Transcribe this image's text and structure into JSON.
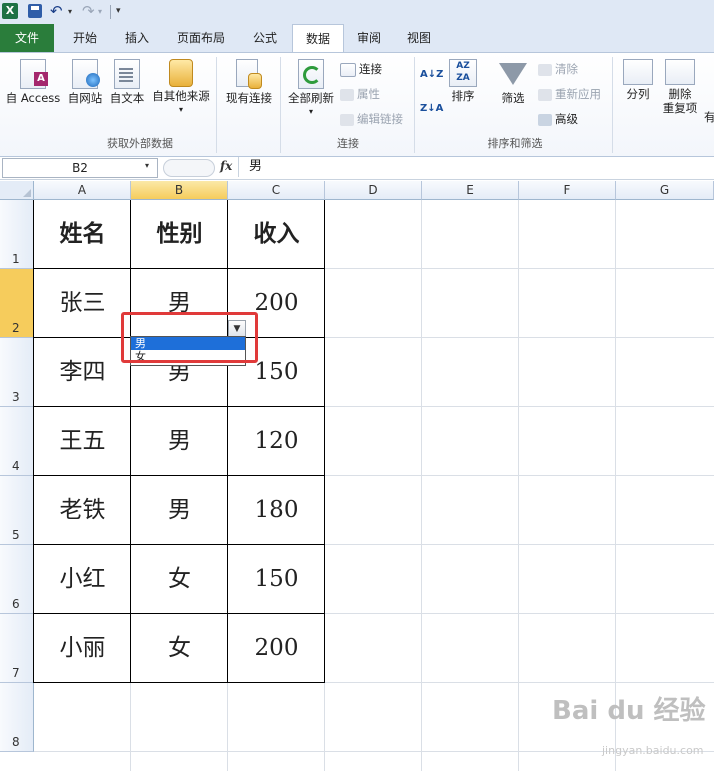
{
  "quick_access": {
    "app_icon": "X",
    "undo": "↶",
    "redo": "↷",
    "dropdown": "▾",
    "customize": "▾"
  },
  "tabs": [
    {
      "label": "文件",
      "type": "file"
    },
    {
      "label": "开始"
    },
    {
      "label": "插入"
    },
    {
      "label": "页面布局"
    },
    {
      "label": "公式"
    },
    {
      "label": "数据",
      "active": true
    },
    {
      "label": "审阅"
    },
    {
      "label": "视图"
    }
  ],
  "ribbon": {
    "external_data": {
      "group_label": "获取外部数据",
      "access": "自 Access",
      "web": "自网站",
      "text": "自文本",
      "other": "自其他来源",
      "existing": "现有连接"
    },
    "connections": {
      "group_label": "连接",
      "refresh_all": "全部刷新",
      "connections": "连接",
      "properties": "属性",
      "edit_links": "编辑链接"
    },
    "sort_filter": {
      "group_label": "排序和筛选",
      "sort_az": "A↓Z",
      "sort_za": "Z↓A",
      "sort": "排序",
      "filter": "筛选",
      "clear": "清除",
      "reapply": "重新应用",
      "advanced": "高级"
    },
    "data_tools": {
      "split": "分列",
      "remove": "删除",
      "duplicates": "重复项",
      "more": "有"
    }
  },
  "formula_bar": {
    "name_box": "B2",
    "fx": "fx",
    "formula": "男"
  },
  "columns": [
    "A",
    "B",
    "C",
    "D",
    "E",
    "F",
    "G"
  ],
  "rows": [
    "1",
    "2",
    "3",
    "4",
    "5",
    "6",
    "7",
    "8"
  ],
  "table": {
    "header": [
      "姓名",
      "性别",
      "收入"
    ],
    "rows": [
      [
        "张三",
        "男",
        "200"
      ],
      [
        "李四",
        "男",
        "150"
      ],
      [
        "王五",
        "男",
        "120"
      ],
      [
        "老铁",
        "男",
        "180"
      ],
      [
        "小红",
        "女",
        "150"
      ],
      [
        "小丽",
        "女",
        "200"
      ]
    ]
  },
  "validation_dropdown": {
    "options": [
      "男",
      "女"
    ],
    "selected_index": 0
  },
  "watermark": {
    "logo": "Bai du 经验",
    "sub": "jingyan.baidu.com"
  },
  "colors": {
    "file_tab": "#2a7d3b",
    "selected_header": "#f6cc5c",
    "highlight": "#e03a3a",
    "list_select": "#1e6fd9"
  }
}
